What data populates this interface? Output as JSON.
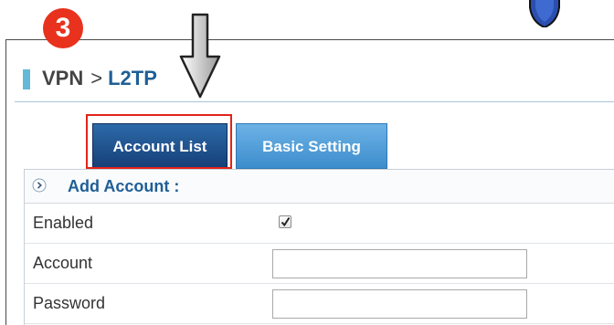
{
  "step_badge": "3",
  "breadcrumb": {
    "section": "VPN",
    "separator": ">",
    "current": "L2TP"
  },
  "tabs": [
    {
      "label": "Account List",
      "active": true
    },
    {
      "label": "Basic Setting",
      "active": false
    }
  ],
  "panel": {
    "title": "Add Account :"
  },
  "form": {
    "enabled_label": "Enabled",
    "enabled_checked": true,
    "account_label": "Account",
    "account_value": "",
    "password_label": "Password",
    "password_value": ""
  },
  "colors": {
    "accent": "#64b8d8",
    "title_blue": "#1f5f96",
    "highlight_red": "#e2231a",
    "badge_red": "#e8321e"
  },
  "icons": [
    "shield-icon",
    "pointer-arrow-icon",
    "expand-icon",
    "checkmark-icon"
  ]
}
